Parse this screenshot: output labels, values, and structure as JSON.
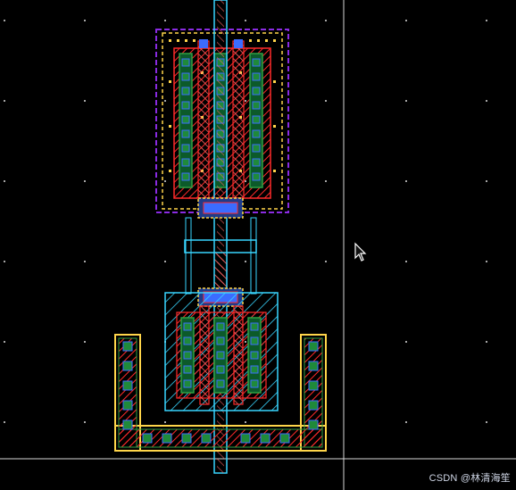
{
  "window": {
    "title": ""
  },
  "watermark": {
    "text": "CSDN @林清海笙"
  },
  "colors": {
    "background": "#000000",
    "poly": "#ff2a2a",
    "active": "#2ea043",
    "nwell": "#8a2be2",
    "metal1": "#3b6cff",
    "contact": "#ffd54a",
    "boundary": "#ffd54a",
    "gate": "#39d6ff",
    "crosshair": "#d9d9d9"
  },
  "view": {
    "cursor": "arrow-pointer-icon",
    "grid": "dots"
  }
}
